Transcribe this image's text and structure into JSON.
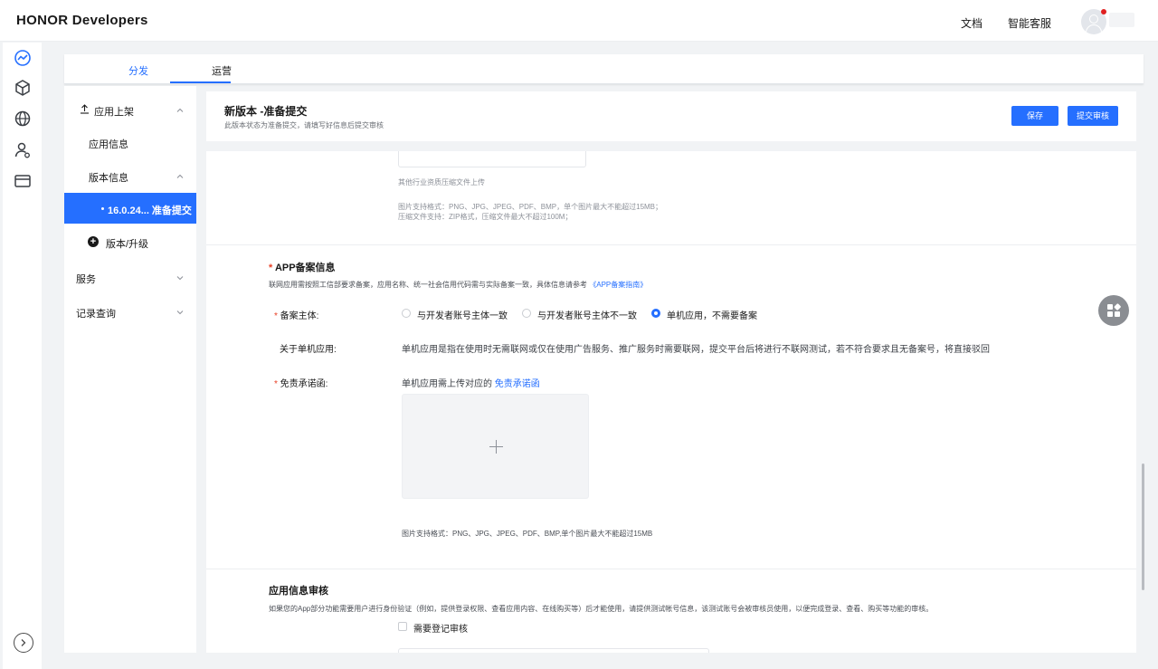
{
  "header": {
    "brand": "HONOR Developers",
    "links": [
      "文档",
      "智能客服"
    ]
  },
  "tabs": [
    {
      "label": "分发",
      "active": true
    },
    {
      "label": "运营",
      "active": false
    }
  ],
  "sidebar": {
    "items": [
      {
        "label": "应用上架"
      },
      {
        "label": "应用信息"
      },
      {
        "label": "版本信息"
      },
      {
        "label": "16.0.24... 准备提交",
        "active": true
      },
      {
        "label": "版本/升级"
      },
      {
        "label": "服务"
      },
      {
        "label": "记录查询"
      }
    ]
  },
  "page": {
    "title": "新版本 -准备提交",
    "subtitle": "此版本状态为准备提交，请填写好信息后提交审核",
    "save_label": "保存",
    "submit_label": "提交审核"
  },
  "upload_section": {
    "hint": "其他行业资质压缩文件上传",
    "format_line1": "图片支持格式：PNG、JPG、JPEG、PDF、BMP，单个图片最大不能超过15MB；",
    "format_line2": "压缩文件支持：ZIP格式，压缩文件最大不超过100M；"
  },
  "app_filing": {
    "title": "APP备案信息",
    "desc": "联网应用需按照工信部要求备案，应用名称、统一社会信用代码需与实际备案一致，具体信息请参考",
    "guide_link": "《APP备案指南》",
    "subject_label": "备案主体:",
    "options": [
      {
        "label": "与开发者账号主体一致",
        "selected": false
      },
      {
        "label": "与开发者账号主体不一致",
        "selected": false
      },
      {
        "label": "单机应用，不需要备案",
        "selected": true
      }
    ],
    "about_label": "关于单机应用:",
    "about_text": "单机应用是指在使用时无需联网或仅在使用广告服务、推广服务时需要联网，提交平台后将进行不联网测试，若不符合要求且无备案号，将直接驳回",
    "disclaimer_label": "免责承诺函:",
    "disclaimer_text": "单机应用需上传对应的",
    "disclaimer_link": "免责承诺函",
    "format_hint": "图片支持格式：PNG、JPG、JPEG、PDF、BMP,单个图片最大不能超过15MB"
  },
  "app_review": {
    "title": "应用信息审核",
    "desc": "如果您的App部分功能需要用户进行身份验证（例如，提供登录权限、查看应用内容、在线购买等）后才能使用，请提供测试帐号信息，该测试账号会被审核员使用，以便完成登录、查看、购买等功能的审核。",
    "checkbox_label": "需要登记审核"
  },
  "colors": {
    "accent": "#256FFF",
    "required": "#E84026"
  }
}
